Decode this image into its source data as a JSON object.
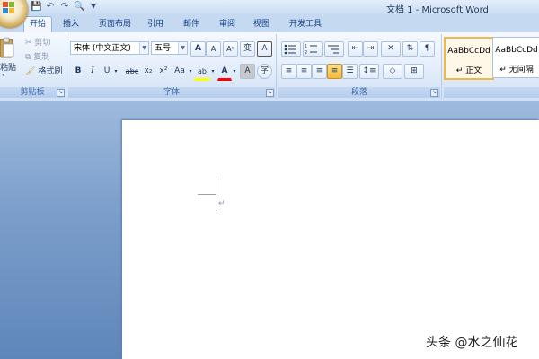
{
  "window": {
    "title": "文档 1 - Microsoft Word"
  },
  "quick_access": {
    "icons": [
      "save-icon",
      "undo-icon",
      "redo-icon",
      "print-preview-icon",
      "customize-dropdown-icon"
    ],
    "glyphs": {
      "save": "💾",
      "undo": "↶",
      "redo": "↷",
      "preview": "🔍",
      "customize": "▾"
    }
  },
  "tabs": [
    "开始",
    "插入",
    "页面布局",
    "引用",
    "邮件",
    "审阅",
    "视图",
    "开发工具"
  ],
  "active_tab": "开始",
  "clipboard": {
    "paste_label": "粘贴",
    "cut_label": "剪切",
    "copy_label": "复制",
    "format_painter_label": "格式刷",
    "group_label": "剪贴板"
  },
  "font": {
    "font_name": "宋体 (中文正文)",
    "font_size": "五号",
    "group_label": "字体",
    "buttons": {
      "grow": "A",
      "shrink": "A",
      "clear": "Aᵅ",
      "phonetic": "变",
      "border": "A",
      "bold": "B",
      "italic": "I",
      "underline": "U",
      "strike": "abc",
      "subscript": "x₂",
      "superscript": "x²",
      "case": "Aa",
      "highlight": "ab",
      "color": "A",
      "shade": "A",
      "enclose": "字"
    }
  },
  "paragraph": {
    "group_label": "段落"
  },
  "styles": [
    {
      "sample": "AaBbCcDd",
      "name": "↵ 正文"
    },
    {
      "sample": "AaBbCcDd",
      "name": "↵ 无间隔"
    }
  ],
  "colors": {
    "accent": "#f2b749",
    "ribbon": "#dfe9f7",
    "background": "#6a8fbf"
  },
  "document": {
    "paragraph_mark": "↵"
  },
  "watermark": "头条 @水之仙花"
}
